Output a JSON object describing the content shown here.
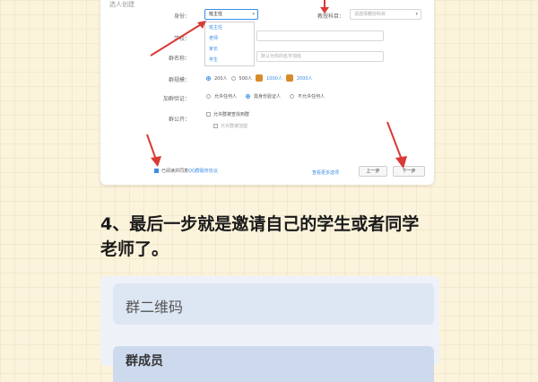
{
  "form": {
    "section_title": "选人创建",
    "identity_label": "身份：",
    "identity_value": "班主任",
    "identity_options": [
      "班主任",
      "老师",
      "家长",
      "学生"
    ],
    "subject_label": "教授科目：",
    "subject_placeholder": "请选择教授科目",
    "school_label": "学校：",
    "group_name_label": "群名称：",
    "group_name_placeholder": "默认为你的名字加班",
    "group_size_label": "群规模：",
    "group_size_options": [
      "200人",
      "500人",
      "1000人",
      "2000人"
    ],
    "join_verify_label": "加群验证：",
    "join_verify_options": [
      "允许任何人",
      "需身份验证人",
      "不允许任何人"
    ],
    "group_public_label": "群公开：",
    "public_options": [
      "允许群被查找到群",
      "允许群被加盟"
    ],
    "agree_text": "已阅读并同意",
    "agree_link": "QQ群服务协议",
    "advanced_link": "查看更多选项",
    "prev_button": "上一步",
    "next_button": "下一步"
  },
  "instruction": {
    "line1": "4、最后一步就是邀请自己的学生或者同学",
    "line2": "老师了。"
  },
  "panel": {
    "qr_label": "群二维码",
    "members_label": "群成员"
  },
  "colors": {
    "accent": "#3a8ee6",
    "arrow": "#d93a35",
    "background": "#fbf3dc"
  }
}
